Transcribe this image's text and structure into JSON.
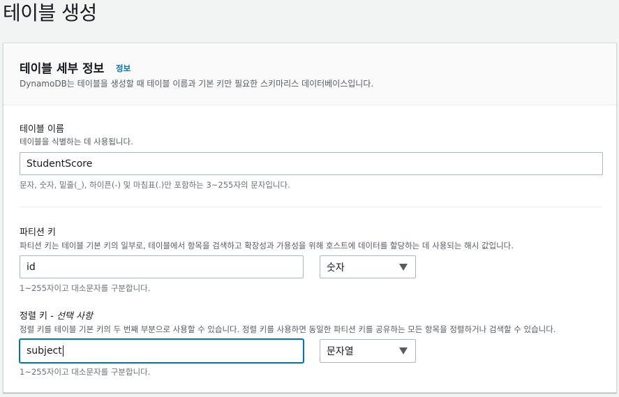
{
  "page": {
    "title": "테이블 생성"
  },
  "panel": {
    "title": "테이블 세부 정보",
    "info_link": "정보",
    "description": "DynamoDB는 테이블을 생성할 때 테이블 이름과 기본 키만 필요한 스키마리스 데이터베이스입니다."
  },
  "table_name": {
    "label": "테이블 이름",
    "description": "테이블을 식별하는 데 사용됩니다.",
    "value": "StudentScore",
    "constraint": "문자, 숫자, 밑줄(_), 하이픈(-) 및 마침표(.)만 포함하는 3~255자의 문자입니다."
  },
  "partition_key": {
    "label": "파티션 키",
    "description": "파티션 키는 테이블 기본 키의 일부로, 테이블에서 항목을 검색하고 확장성과 가용성을 위해 호스트에 데이터를 할당하는 데 사용되는 해시 값입니다.",
    "value": "id",
    "type_selected": "숫자",
    "constraint": "1~255자이고 대소문자를 구분합니다."
  },
  "sort_key": {
    "label": "정렬 키",
    "label_optional": " - 선택 사항",
    "description": "정렬 키를 테이블 기본 키의 두 번째 부분으로 사용할 수 있습니다. 정렬 키를 사용하면 동일한 파티션 키를 공유하는 모든 항목을 정렬하거나 검색할 수 있습니다.",
    "value": "subject",
    "type_selected": "문자열",
    "constraint": "1~255자이고 대소문자를 구분합니다."
  },
  "colors": {
    "link": "#0073bb",
    "focus": "#0073bb",
    "background": "#f2f3f3"
  }
}
